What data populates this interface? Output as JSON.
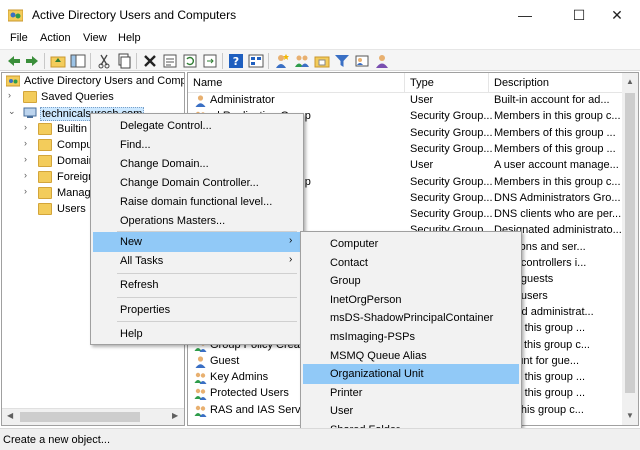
{
  "window": {
    "title": "Active Directory Users and Computers",
    "minimize": "—",
    "maximize": "☐",
    "close": "✕"
  },
  "menu": [
    "File",
    "Action",
    "View",
    "Help"
  ],
  "tree": {
    "root": "Active Directory Users and Computers",
    "saved_queries": "Saved Queries",
    "domain": "technicalsuresh.com",
    "children": [
      "Builtin",
      "Compu",
      "Domain",
      "Foreign",
      "Manage",
      "Users"
    ]
  },
  "list": {
    "headers": {
      "name": "Name",
      "type": "Type",
      "description": "Description"
    },
    "rows": [
      {
        "name": "Administrator",
        "type": "User",
        "desc": "Built-in account for ad..."
      },
      {
        "name": "rd Replication Group",
        "type": "Security Group...",
        "desc": "Members in this group c..."
      },
      {
        "name": "",
        "type": "Security Group...",
        "desc": "Members of this group ..."
      },
      {
        "name": "ntrollers",
        "type": "Security Group...",
        "desc": "Members of this group ..."
      },
      {
        "name": "",
        "type": "User",
        "desc": "A user account manage..."
      },
      {
        "name": "rd Replication Group",
        "type": "Security Group...",
        "desc": "Members in this group c..."
      },
      {
        "name": "",
        "type": "Security Group...",
        "desc": "DNS Administrators Gro..."
      },
      {
        "name": "",
        "type": "Security Group...",
        "desc": "DNS clients who are per..."
      },
      {
        "name": "",
        "type": "Security Group...",
        "desc": "Designated administrato..."
      },
      {
        "name": "",
        "type": "",
        "desc": "kstations and ser..."
      },
      {
        "name": "",
        "type": "",
        "desc": "main controllers i..."
      },
      {
        "name": "",
        "type": "",
        "desc": "main guests"
      },
      {
        "name": "",
        "type": "",
        "desc": "main users"
      },
      {
        "name": "",
        "type": "",
        "desc": "gnated administrat..."
      },
      {
        "name": "",
        "type": "",
        "desc": "ers of this group ..."
      },
      {
        "name": "Group Policy Creator",
        "type": "",
        "desc": "ers in this group c..."
      },
      {
        "name": "Guest",
        "type": "",
        "desc": "account for gue..."
      },
      {
        "name": "Key Admins",
        "type": "",
        "desc": "ers of this group ..."
      },
      {
        "name": "Protected Users",
        "type": "",
        "desc": "ers of this group ..."
      },
      {
        "name": "RAS and IAS Servers",
        "type": "",
        "desc": "rs in this group c..."
      }
    ]
  },
  "context_menu": {
    "items": [
      "Delegate Control...",
      "Find...",
      "Change Domain...",
      "Change Domain Controller...",
      "Raise domain functional level...",
      "Operations Masters..."
    ],
    "new": "New",
    "all_tasks": "All Tasks",
    "refresh": "Refresh",
    "properties": "Properties",
    "help": "Help"
  },
  "submenu": {
    "items": [
      "Computer",
      "Contact",
      "Group",
      "InetOrgPerson",
      "msDS-ShadowPrincipalContainer",
      "msImaging-PSPs",
      "MSMQ Queue Alias",
      "Organizational Unit",
      "Printer",
      "User",
      "Shared Folder"
    ],
    "highlighted": "Organizational Unit"
  },
  "status": "Create a new object..."
}
